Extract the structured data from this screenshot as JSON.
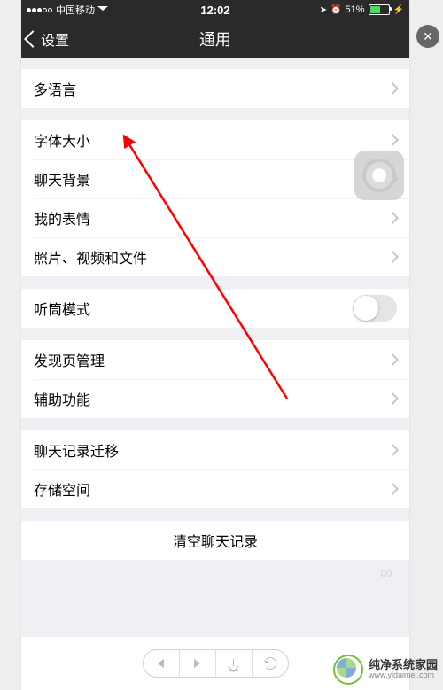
{
  "status": {
    "carrier": "中国移动",
    "time": "12:02",
    "battery_pct": "51%"
  },
  "nav": {
    "back_label": "设置",
    "title": "通用"
  },
  "cells": {
    "language": "多语言",
    "font_size": "字体大小",
    "chat_bg": "聊天背景",
    "stickers": "我的表情",
    "media": "照片、视频和文件",
    "earpiece": "听筒模式",
    "discover": "发现页管理",
    "accessibility": "辅助功能",
    "migrate": "聊天记录迁移",
    "storage": "存储空间",
    "clear": "清空聊天记录"
  },
  "switches": {
    "earpiece_on": false
  },
  "brand": {
    "name": "纯净系统家园",
    "url": "www.yidaimei.com"
  },
  "overlay": {
    "close": "✕"
  }
}
